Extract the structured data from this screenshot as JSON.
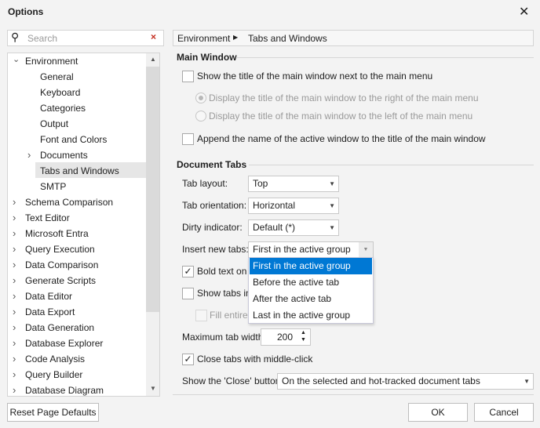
{
  "title": "Options",
  "search": {
    "placeholder": "Search"
  },
  "breadcrumb": [
    "Environment",
    "Tabs and Windows"
  ],
  "tree": {
    "env": "Environment",
    "children": [
      "General",
      "Keyboard",
      "Categories",
      "Output",
      "Font and Colors",
      "Documents",
      "Tabs and Windows",
      "SMTP"
    ],
    "roots": [
      "Schema Comparison",
      "Text Editor",
      "Microsoft Entra",
      "Query Execution",
      "Data Comparison",
      "Generate Scripts",
      "Data Editor",
      "Data Export",
      "Data Generation",
      "Database Explorer",
      "Code Analysis",
      "Query Builder",
      "Database Diagram"
    ]
  },
  "main_window": {
    "header": "Main Window",
    "show_title": "Show the title of the main window next to the main menu",
    "radio_right": "Display the title of the main window to the right of the main menu",
    "radio_left": "Display the title of the main window to the left of the main menu",
    "append": "Append the name of the active window to the title of the main window"
  },
  "doc_tabs": {
    "header": "Document Tabs",
    "tab_layout_label": "Tab layout:",
    "tab_layout": "Top",
    "tab_orient_label": "Tab orientation:",
    "tab_orient": "Horizontal",
    "dirty_label": "Dirty indicator:",
    "dirty": "Default (*)",
    "insert_label": "Insert new tabs:",
    "insert": "First in the active group",
    "insert_options": [
      "First in the active group",
      "Before the active tab",
      "After the active tab",
      "Last in the active group"
    ],
    "bold": "Bold text on s",
    "show_tabs": "Show tabs in",
    "fill": "Fill entire",
    "max_width_label": "Maximum tab width:",
    "max_width": "200",
    "close_middle": "Close tabs with middle-click",
    "close_btn_label": "Show the 'Close' button:",
    "close_btn": "On the selected and hot-tracked document tabs"
  },
  "buttons": {
    "reset": "Reset Page Defaults",
    "ok": "OK",
    "cancel": "Cancel"
  },
  "colors": {
    "accent": "#0078d4",
    "selected": "#e6e6e6"
  }
}
